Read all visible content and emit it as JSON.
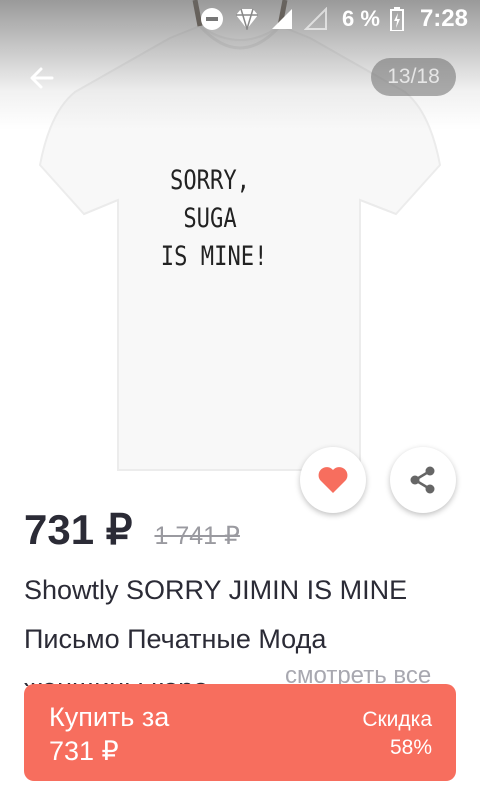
{
  "status_bar": {
    "battery_percent": "6 %",
    "time": "7:28",
    "icons": [
      "do-not-disturb-icon",
      "vpn-icon",
      "signal-icon",
      "no-signal-icon",
      "battery-charging-icon"
    ]
  },
  "gallery": {
    "counter": "13/18",
    "shirt_text": [
      "SORRY,",
      "SUGA",
      "IS MINE!"
    ]
  },
  "product": {
    "price": "731 ₽",
    "old_price": "1 741 ₽",
    "title_lines": [
      "Showtly SORRY JIMIN IS MINE",
      "Письмо Печатные Мода",
      "женщины коро..."
    ],
    "see_all": "смотреть все"
  },
  "buy": {
    "label_line1": "Купить за",
    "label_line2": "731 ₽",
    "discount_label": "Скидка",
    "discount_value": "58%"
  },
  "colors": {
    "accent": "#f76e5e",
    "text_dark": "#2b2b36",
    "muted": "#9a9aa0"
  }
}
